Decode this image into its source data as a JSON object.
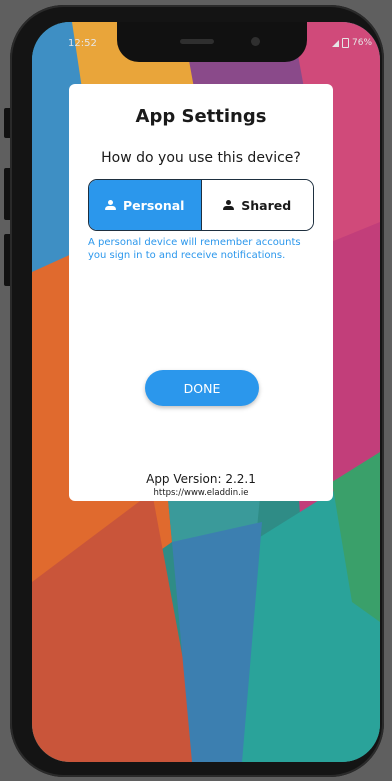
{
  "status_bar": {
    "time": "12:52",
    "battery": "76%"
  },
  "dialog": {
    "title": "App Settings",
    "question": "How do you use this device?",
    "options": [
      {
        "label": "Personal",
        "icon": "person-icon",
        "selected": true
      },
      {
        "label": "Shared",
        "icon": "person-icon",
        "selected": false
      }
    ],
    "hint": "A personal device will remember accounts you sign in to and receive notifications.",
    "done_label": "DONE",
    "version": "App Version: 2.2.1",
    "url": "https://www.eladdin.ie"
  },
  "colors": {
    "accent": "#2b97ec",
    "card": "#ffffff",
    "phone_frame": "#141414"
  }
}
